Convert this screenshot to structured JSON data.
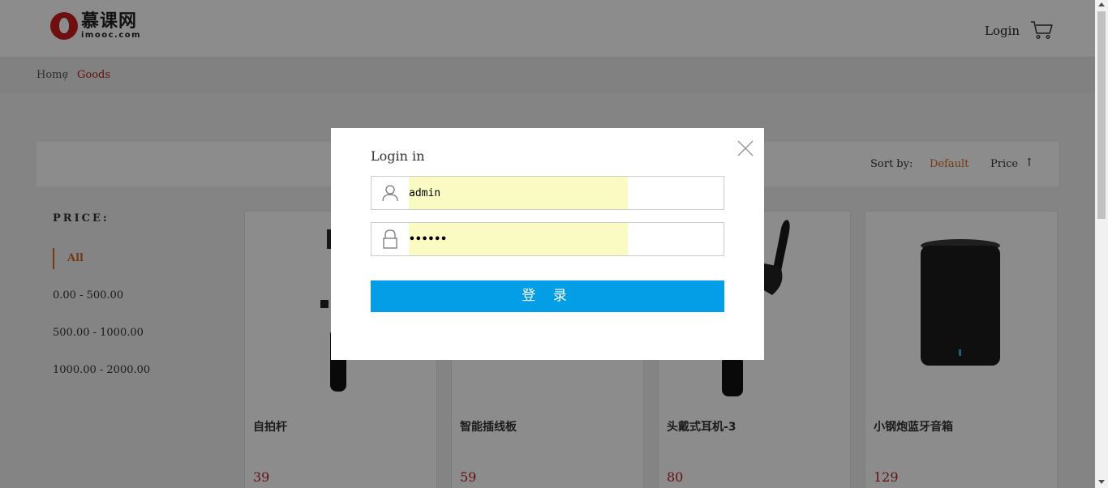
{
  "header": {
    "logo_cn": "慕课网",
    "logo_en": "imooc.com",
    "login_label": "Login",
    "cart_icon": "cart-icon"
  },
  "breadcrumb": {
    "home": "Home",
    "separator": "/",
    "current": "Goods"
  },
  "sort": {
    "label": "Sort by:",
    "default": "Default",
    "price": "Price",
    "price_arrow": "↑"
  },
  "price_filter": {
    "title": "PRICE:",
    "items": [
      "All",
      "0.00 - 500.00",
      "500.00 - 1000.00",
      "1000.00 - 2000.00"
    ]
  },
  "products": [
    {
      "name": "自拍杆",
      "price": "39"
    },
    {
      "name": "智能插线板",
      "price": "59"
    },
    {
      "name": "头戴式耳机-3",
      "price": "80"
    },
    {
      "name": "小钢炮蓝牙音箱",
      "price": "129"
    }
  ],
  "login_modal": {
    "title": "Login in",
    "username_value": "admin",
    "password_value": "••••••",
    "submit_label": "登 录",
    "user_icon": "user-icon",
    "lock_icon": "lock-icon",
    "close_icon": "close-icon"
  },
  "colors": {
    "accent": "#d2691e",
    "price_red": "#b22222",
    "button_blue": "#049ee6",
    "autofill_yellow": "#fafbc3"
  }
}
